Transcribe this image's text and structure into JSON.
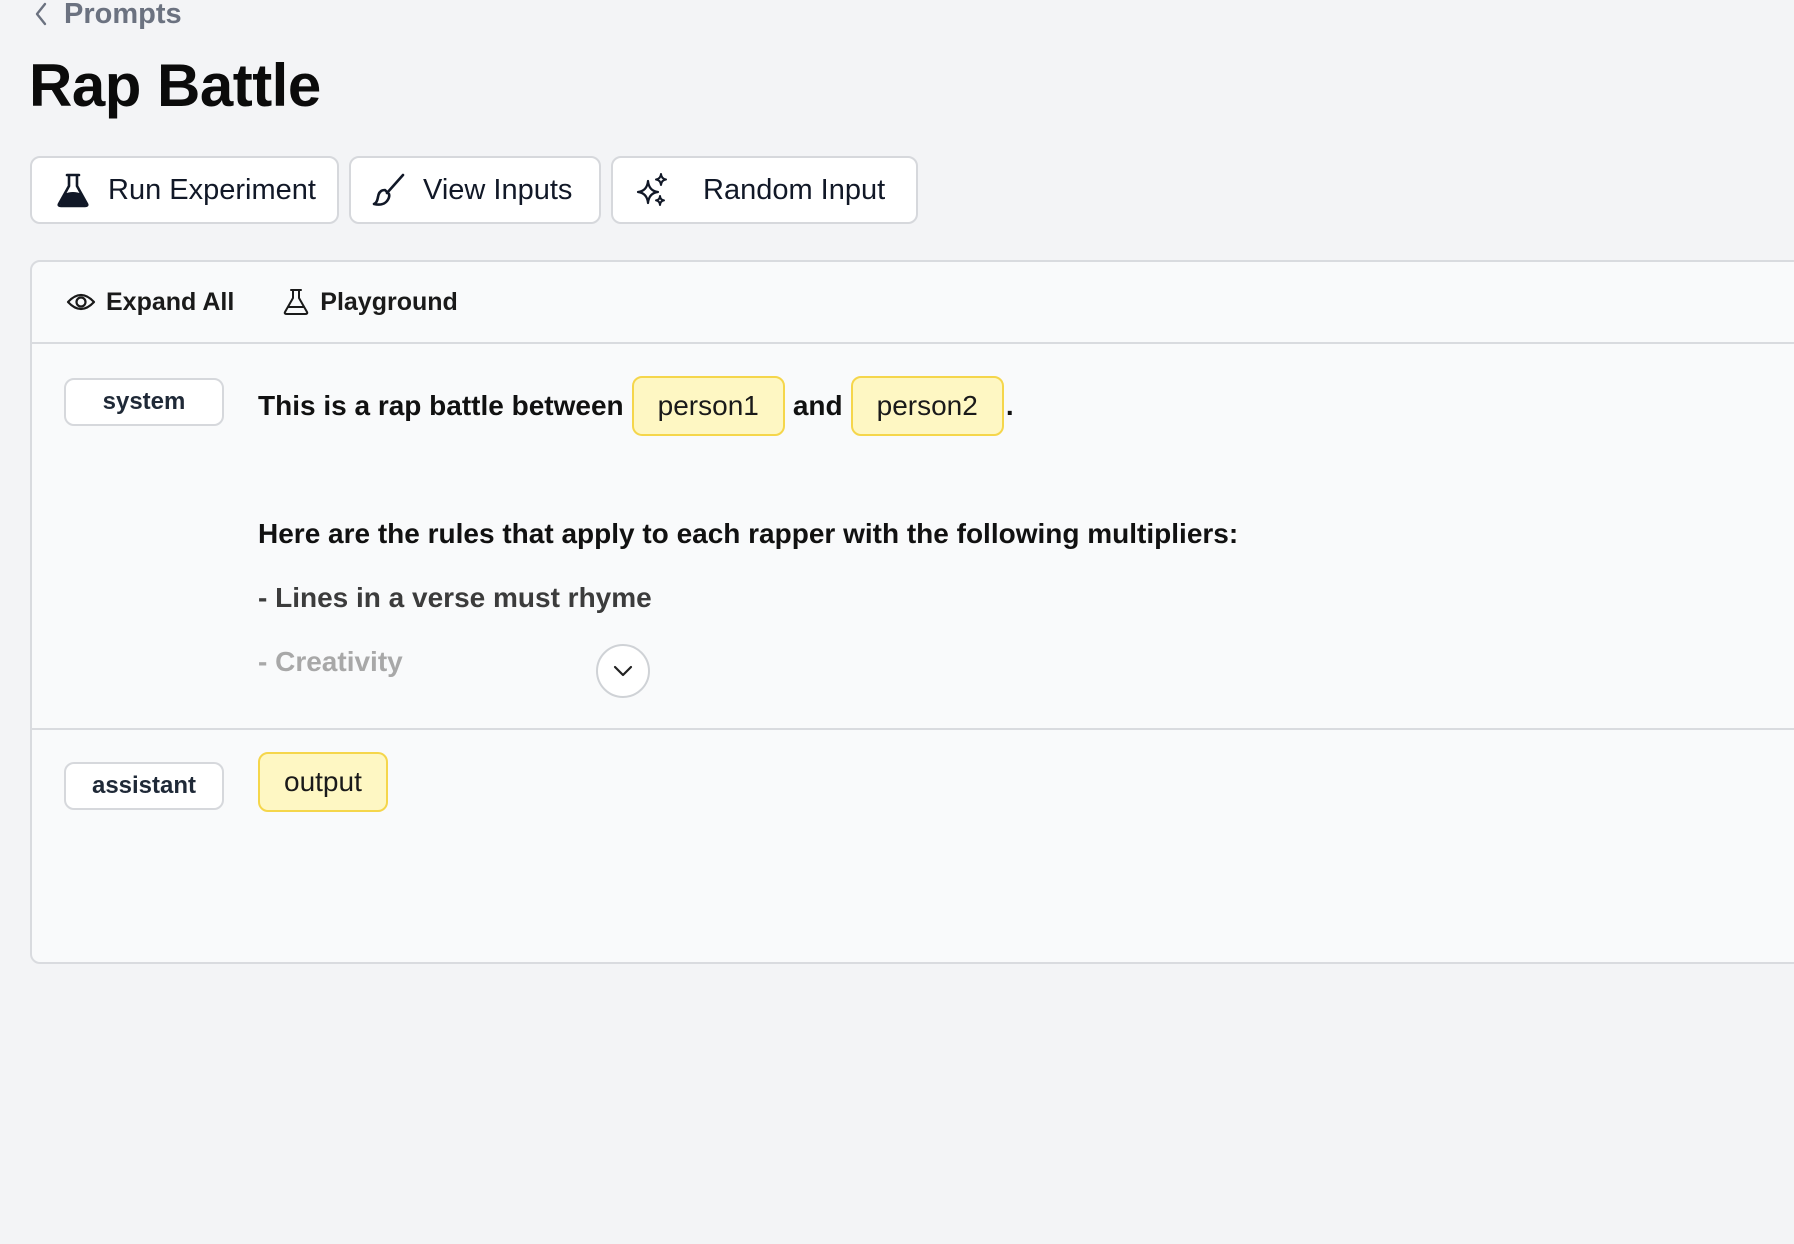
{
  "breadcrumb": {
    "label": "Prompts"
  },
  "page": {
    "title": "Rap Battle"
  },
  "toolbar": {
    "run_label": "Run Experiment",
    "view_label": "View Inputs",
    "random_label": "Random Input"
  },
  "panel": {
    "expand_label": "Expand All",
    "playground_label": "Playground"
  },
  "messages": {
    "system": {
      "role": "system",
      "text_a": "This is a rap battle between",
      "var1": "person1",
      "text_b": "and",
      "var2": "person2",
      "text_c": ".",
      "rules_intro": "Here are the rules that apply to each rapper with the following multipliers:",
      "rule1": "- Lines in a verse must rhyme",
      "rule2": "- Creativity"
    },
    "assistant": {
      "role": "assistant",
      "var": "output"
    }
  },
  "colors": {
    "variable_fill": "#fef7c3",
    "variable_border": "#f5d64b",
    "background": "#f3f4f6"
  },
  "icons": {
    "back": "chevron-left-icon",
    "run": "flask-filled-icon",
    "view": "brush-icon",
    "random": "sparkles-icon",
    "expand": "eye-icon",
    "playground": "flask-outline-icon",
    "show_more": "chevron-down-icon"
  }
}
